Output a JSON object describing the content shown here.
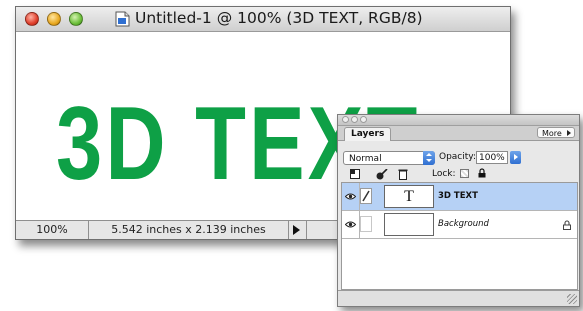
{
  "document_window": {
    "title": "Untitled-1 @ 100% (3D TEXT, RGB/8)",
    "canvas_text": "3D TEXT",
    "text_color": "#0ea046",
    "status": {
      "zoom": "100%",
      "doc_size": "5.542 inches x 2.139 inches"
    }
  },
  "layers_palette": {
    "tab_label": "Layers",
    "more_label": "More",
    "blend_mode": "Normal",
    "opacity_label": "Opacity:",
    "opacity_value": "100%",
    "lock_label": "Lock:",
    "layers": [
      {
        "name": "3D TEXT",
        "thumbnail": "T",
        "selected": true,
        "visible": true
      },
      {
        "name": "Background",
        "selected": false,
        "visible": true,
        "locked": true
      }
    ],
    "selection_color": "#b6d1f5"
  }
}
